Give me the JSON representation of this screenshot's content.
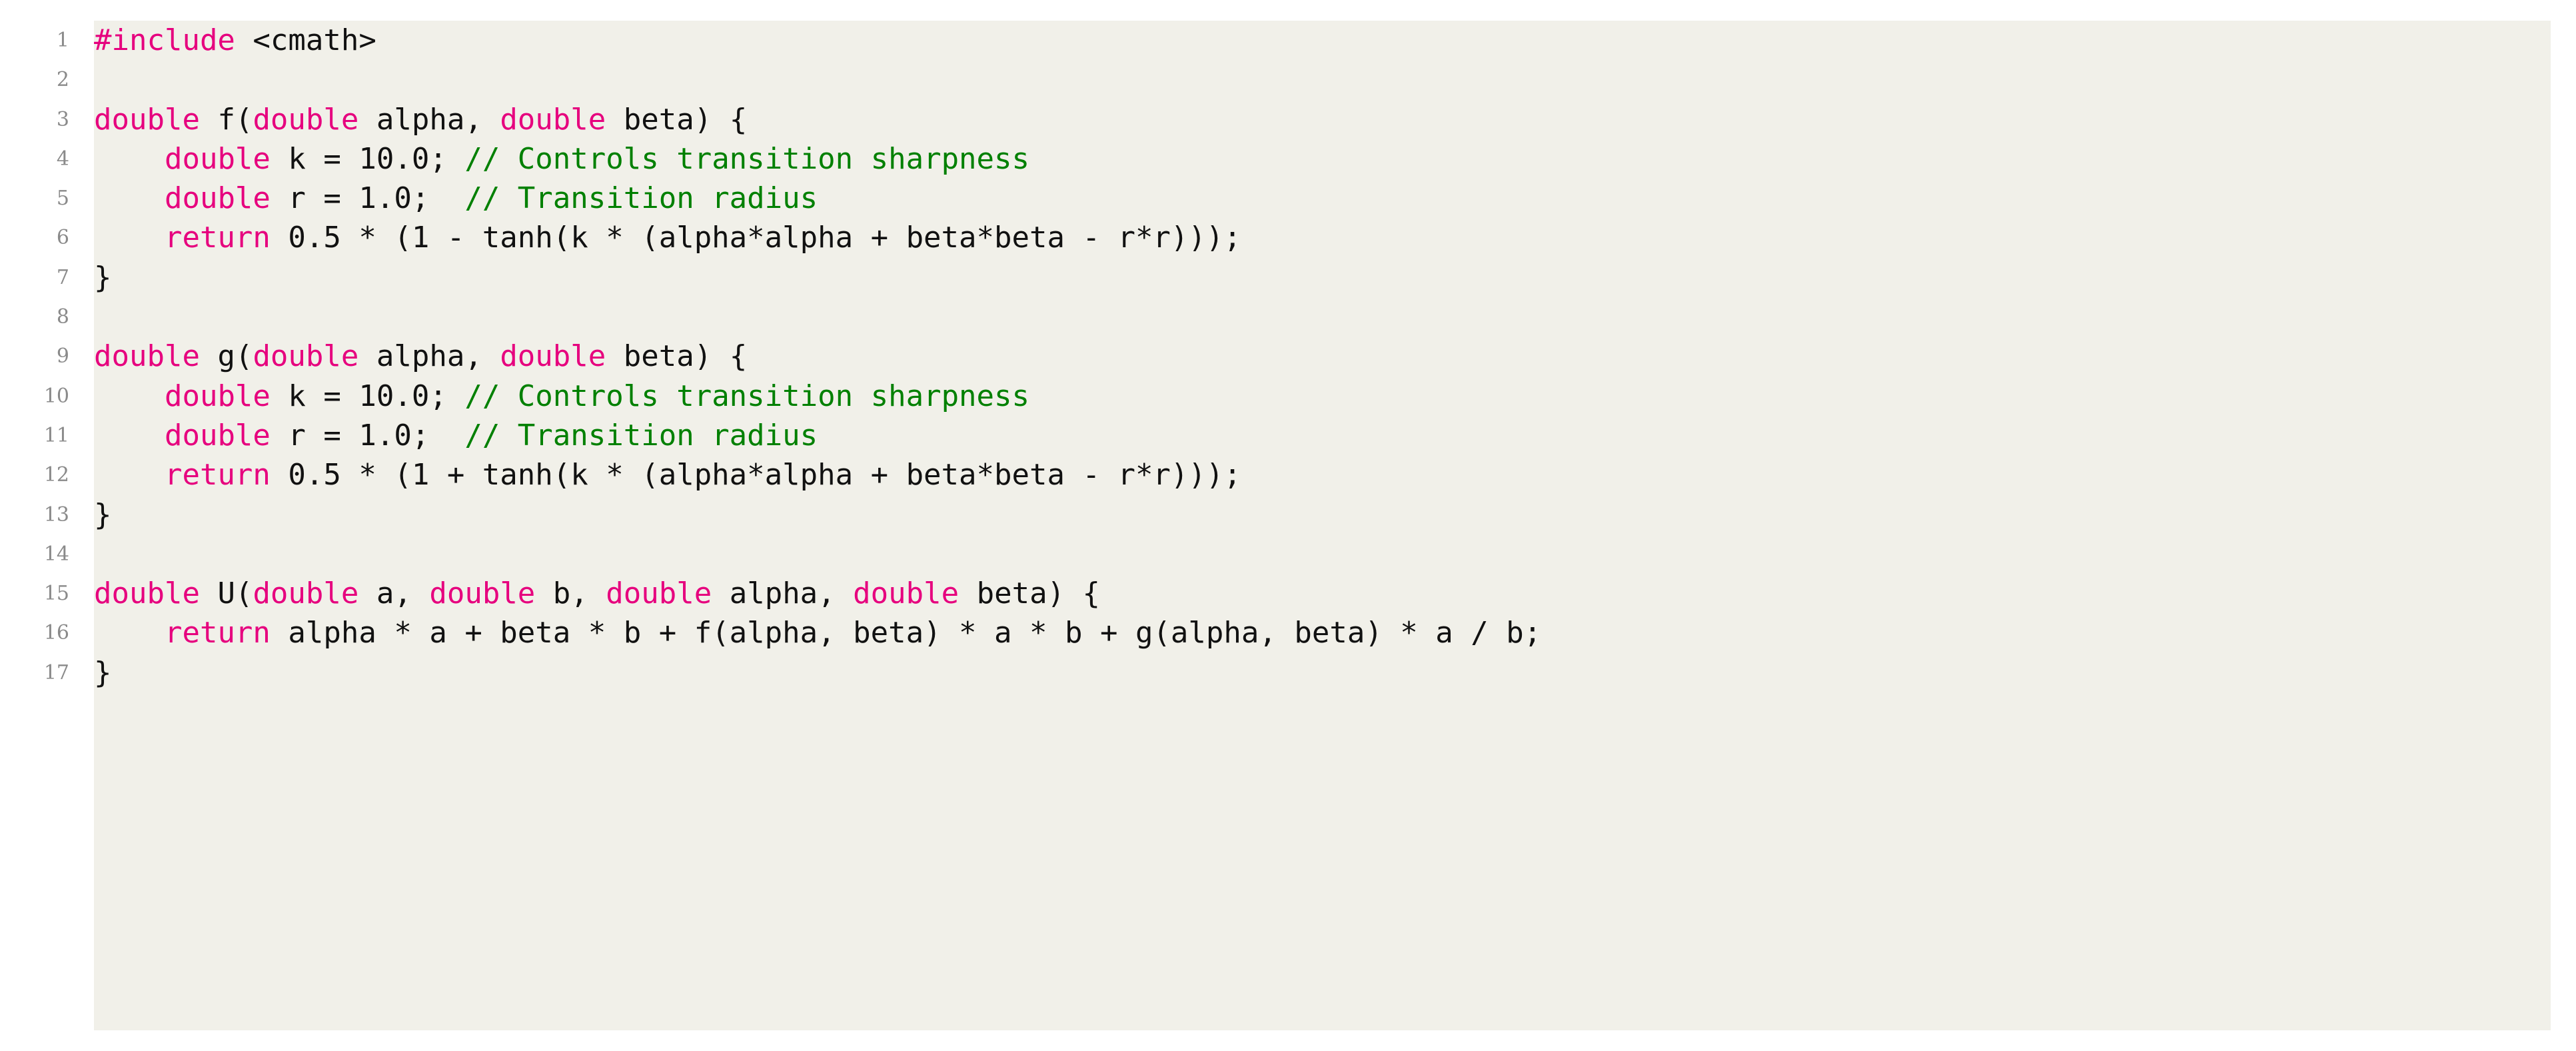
{
  "listing": {
    "language": "C++",
    "background_color": "#f1f0e9",
    "page_color": "#ffffff",
    "keyword_color": "#e6007e",
    "comment_color": "#008000",
    "text_color": "#111111",
    "linenumber_color": "#8a8a8a",
    "lines": [
      {
        "number": "1",
        "tokens": [
          {
            "t": "#include",
            "c": "kw"
          },
          {
            "t": " <cmath>",
            "c": "plain"
          }
        ]
      },
      {
        "number": "2",
        "tokens": []
      },
      {
        "number": "3",
        "tokens": [
          {
            "t": "double",
            "c": "kw"
          },
          {
            "t": " f(",
            "c": "plain"
          },
          {
            "t": "double",
            "c": "kw"
          },
          {
            "t": " alpha, ",
            "c": "plain"
          },
          {
            "t": "double",
            "c": "kw"
          },
          {
            "t": " beta) {",
            "c": "plain"
          }
        ]
      },
      {
        "number": "4",
        "tokens": [
          {
            "t": "    ",
            "c": "plain"
          },
          {
            "t": "double",
            "c": "kw"
          },
          {
            "t": " k = 10.0; ",
            "c": "plain"
          },
          {
            "t": "// Controls transition sharpness",
            "c": "comment"
          }
        ]
      },
      {
        "number": "5",
        "tokens": [
          {
            "t": "    ",
            "c": "plain"
          },
          {
            "t": "double",
            "c": "kw"
          },
          {
            "t": " r = 1.0;  ",
            "c": "plain"
          },
          {
            "t": "// Transition radius",
            "c": "comment"
          }
        ]
      },
      {
        "number": "6",
        "tokens": [
          {
            "t": "    ",
            "c": "plain"
          },
          {
            "t": "return",
            "c": "kw"
          },
          {
            "t": " 0.5 * (1 - tanh(k * (alpha*alpha + beta*beta - r*r)));",
            "c": "plain"
          }
        ]
      },
      {
        "number": "7",
        "tokens": [
          {
            "t": "}",
            "c": "plain"
          }
        ]
      },
      {
        "number": "8",
        "tokens": []
      },
      {
        "number": "9",
        "tokens": [
          {
            "t": "double",
            "c": "kw"
          },
          {
            "t": " g(",
            "c": "plain"
          },
          {
            "t": "double",
            "c": "kw"
          },
          {
            "t": " alpha, ",
            "c": "plain"
          },
          {
            "t": "double",
            "c": "kw"
          },
          {
            "t": " beta) {",
            "c": "plain"
          }
        ]
      },
      {
        "number": "10",
        "tokens": [
          {
            "t": "    ",
            "c": "plain"
          },
          {
            "t": "double",
            "c": "kw"
          },
          {
            "t": " k = 10.0; ",
            "c": "plain"
          },
          {
            "t": "// Controls transition sharpness",
            "c": "comment"
          }
        ]
      },
      {
        "number": "11",
        "tokens": [
          {
            "t": "    ",
            "c": "plain"
          },
          {
            "t": "double",
            "c": "kw"
          },
          {
            "t": " r = 1.0;  ",
            "c": "plain"
          },
          {
            "t": "// Transition radius",
            "c": "comment"
          }
        ]
      },
      {
        "number": "12",
        "tokens": [
          {
            "t": "    ",
            "c": "plain"
          },
          {
            "t": "return",
            "c": "kw"
          },
          {
            "t": " 0.5 * (1 + tanh(k * (alpha*alpha + beta*beta - r*r)));",
            "c": "plain"
          }
        ]
      },
      {
        "number": "13",
        "tokens": [
          {
            "t": "}",
            "c": "plain"
          }
        ]
      },
      {
        "number": "14",
        "tokens": []
      },
      {
        "number": "15",
        "tokens": [
          {
            "t": "double",
            "c": "kw"
          },
          {
            "t": " U(",
            "c": "plain"
          },
          {
            "t": "double",
            "c": "kw"
          },
          {
            "t": " a, ",
            "c": "plain"
          },
          {
            "t": "double",
            "c": "kw"
          },
          {
            "t": " b, ",
            "c": "plain"
          },
          {
            "t": "double",
            "c": "kw"
          },
          {
            "t": " alpha, ",
            "c": "plain"
          },
          {
            "t": "double",
            "c": "kw"
          },
          {
            "t": " beta) {",
            "c": "plain"
          }
        ]
      },
      {
        "number": "16",
        "tokens": [
          {
            "t": "    ",
            "c": "plain"
          },
          {
            "t": "return",
            "c": "kw"
          },
          {
            "t": " alpha * a + beta * b + f(alpha, beta) * a * b + g(alpha, beta) * a / b;",
            "c": "plain"
          }
        ]
      },
      {
        "number": "17",
        "tokens": [
          {
            "t": "}",
            "c": "plain"
          }
        ]
      }
    ]
  }
}
